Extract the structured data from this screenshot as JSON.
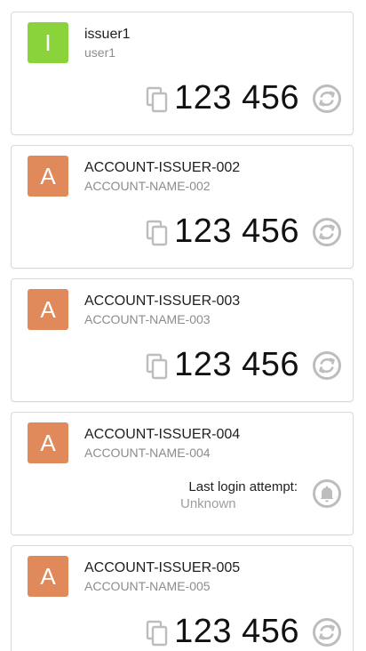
{
  "colors": {
    "avatar_green": "#8bd33a",
    "avatar_orange": "#e0895a",
    "icon_grey": "#bdbdbd"
  },
  "accounts": [
    {
      "avatar_letter": "I",
      "avatar_color": "#8bd33a",
      "issuer": "issuer1",
      "account": "user1",
      "code": "123 456",
      "copy_icon": "copy-icon",
      "action_icon": "refresh-icon"
    },
    {
      "avatar_letter": "A",
      "avatar_color": "#e0895a",
      "issuer": "ACCOUNT-ISSUER-002",
      "account": "ACCOUNT-NAME-002",
      "code": "123 456",
      "copy_icon": "copy-icon",
      "action_icon": "refresh-icon"
    },
    {
      "avatar_letter": "A",
      "avatar_color": "#e0895a",
      "issuer": "ACCOUNT-ISSUER-003",
      "account": "ACCOUNT-NAME-003",
      "code": "123 456",
      "copy_icon": "copy-icon",
      "action_icon": "refresh-icon"
    },
    {
      "avatar_letter": "A",
      "avatar_color": "#e0895a",
      "issuer": "ACCOUNT-ISSUER-004",
      "account": "ACCOUNT-NAME-004",
      "login_label": "Last login attempt:",
      "login_value": "Unknown",
      "action_icon": "bell-icon"
    },
    {
      "avatar_letter": "A",
      "avatar_color": "#e0895a",
      "issuer": "ACCOUNT-ISSUER-005",
      "account": "ACCOUNT-NAME-005",
      "code": "123 456",
      "copy_icon": "copy-icon",
      "action_icon": "refresh-icon"
    }
  ]
}
